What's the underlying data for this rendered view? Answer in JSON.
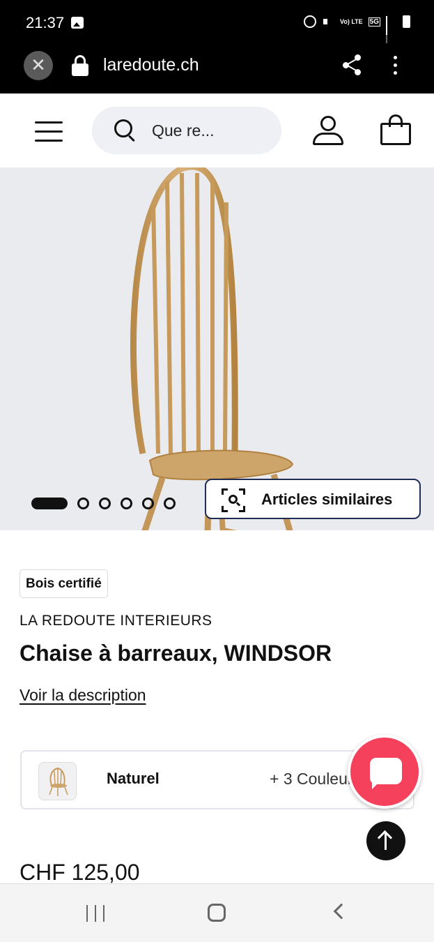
{
  "status_bar": {
    "time": "21:37",
    "network_label": "Vo) LTE",
    "network_type": "5G"
  },
  "browser": {
    "url": "laredoute.ch",
    "close_symbol": "✕"
  },
  "header": {
    "search_placeholder": "Que re..."
  },
  "gallery": {
    "slide_count": 6,
    "active_slide": 1,
    "similar_button_label": "Articles similaires"
  },
  "product": {
    "badge": "Bois certifié",
    "brand": "LA REDOUTE INTERIEURS",
    "title": "Chaise à barreaux, WINDSOR",
    "description_link": "Voir la description",
    "color_name": "Naturel",
    "more_colors": "+ 3 Couleurs",
    "price": "CHF 125,00"
  },
  "colors": {
    "chat_button": "#f5415c",
    "similar_border": "#1f2d54",
    "gallery_bg": "#eaebef",
    "wood": "#c9a062"
  },
  "icons": [
    "image-icon",
    "alarm-icon",
    "mute-icon",
    "signal-icon",
    "battery-icon",
    "close-icon",
    "lock-icon",
    "share-icon",
    "more-vert-icon",
    "hamburger-icon",
    "search-icon",
    "user-icon",
    "bag-icon",
    "scan-icon",
    "chat-icon",
    "arrow-up-icon",
    "recent-apps-icon",
    "home-icon",
    "back-icon"
  ]
}
